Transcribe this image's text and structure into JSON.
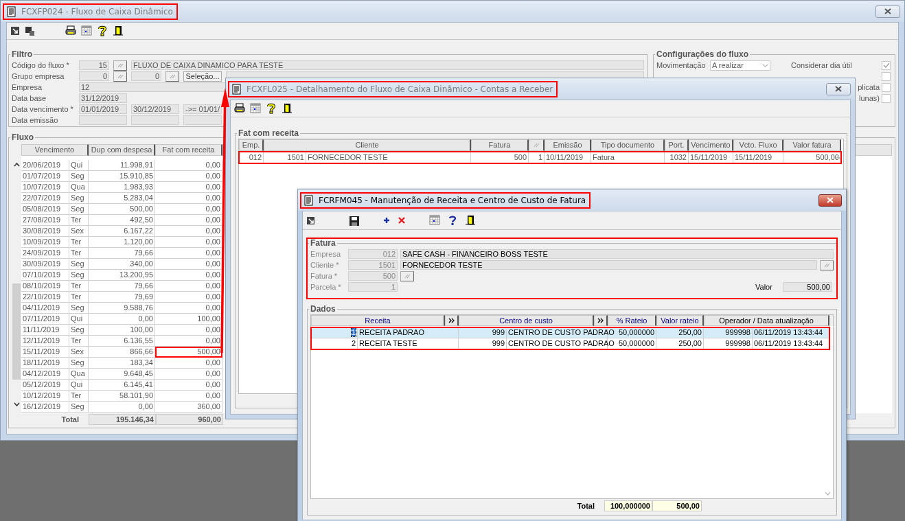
{
  "main_window": {
    "title": "FCXFP024 - Fluxo de Caixa Dinâmico",
    "highlighted": true,
    "filter": {
      "title": "Filtro",
      "rows": [
        {
          "label": "Código do fluxo *",
          "cells": [
            {
              "kind": "num",
              "text": "15"
            },
            {
              "kind": "lookup"
            },
            {
              "kind": "desc",
              "text": "FLUXO DE CAIXA DINAMICO PARA TESTE"
            }
          ]
        },
        {
          "label": "Grupo empresa",
          "cells": [
            {
              "kind": "num",
              "text": "0"
            },
            {
              "kind": "lookup"
            },
            {
              "kind": "num",
              "text": "0"
            },
            {
              "kind": "lookup"
            },
            {
              "kind": "button",
              "text": "Seleção..."
            },
            {
              "kind": "desc"
            }
          ]
        },
        {
          "label": "Empresa",
          "cells": [
            {
              "kind": "desc",
              "text": "12"
            }
          ]
        },
        {
          "label": "Data base",
          "cells": [
            {
              "kind": "date",
              "text": "31/12/2019"
            }
          ]
        },
        {
          "label": "Data vencimento *",
          "cells": [
            {
              "kind": "date",
              "text": "01/01/2019"
            },
            {
              "kind": "date",
              "text": "30/12/2019"
            },
            {
              "kind": "date",
              "text": "->= 01/01/"
            }
          ]
        },
        {
          "label": "Data emissão",
          "cells": [
            {
              "kind": "date"
            },
            {
              "kind": "date"
            },
            {
              "kind": "date"
            }
          ]
        }
      ]
    },
    "config": {
      "title": "Configurações do fluxo",
      "movement": {
        "label": "Movimentação",
        "value": "A realizar"
      },
      "checks": [
        {
          "label": "Considerar dia útil",
          "checked": true
        },
        {
          "checked": false
        },
        {
          "label": "plicata",
          "checked": false
        },
        {
          "label": "lunas)",
          "checked": false
        }
      ]
    },
    "flow": {
      "title": "Fluxo",
      "columns": [
        "Vencimento",
        "Dup com despesa",
        "Fat com receita"
      ],
      "rows": [
        {
          "date": "20/06/2019",
          "weekday": "Qui",
          "dup": "11.998,91",
          "fat": "0,00",
          "highlighted": false
        },
        {
          "date": "01/07/2019",
          "weekday": "Seg",
          "dup": "15.910,85",
          "fat": "0,00",
          "highlighted": false
        },
        {
          "date": "10/07/2019",
          "weekday": "Qua",
          "dup": "1.983,93",
          "fat": "0,00",
          "highlighted": false
        },
        {
          "date": "22/07/2019",
          "weekday": "Seg",
          "dup": "5.283,04",
          "fat": "0,00",
          "highlighted": false
        },
        {
          "date": "05/08/2019",
          "weekday": "Seg",
          "dup": "500,00",
          "fat": "0,00",
          "highlighted": false
        },
        {
          "date": "27/08/2019",
          "weekday": "Ter",
          "dup": "492,50",
          "fat": "0,00",
          "highlighted": false
        },
        {
          "date": "30/08/2019",
          "weekday": "Sex",
          "dup": "6.167,22",
          "fat": "0,00",
          "highlighted": false
        },
        {
          "date": "10/09/2019",
          "weekday": "Ter",
          "dup": "1.120,00",
          "fat": "0,00",
          "highlighted": false
        },
        {
          "date": "24/09/2019",
          "weekday": "Ter",
          "dup": "79,66",
          "fat": "0,00",
          "highlighted": false
        },
        {
          "date": "30/09/2019",
          "weekday": "Seg",
          "dup": "340,00",
          "fat": "0,00",
          "highlighted": false
        },
        {
          "date": "07/10/2019",
          "weekday": "Seg",
          "dup": "13.200,95",
          "fat": "0,00",
          "highlighted": false
        },
        {
          "date": "08/10/2019",
          "weekday": "Ter",
          "dup": "79,66",
          "fat": "0,00",
          "highlighted": false
        },
        {
          "date": "22/10/2019",
          "weekday": "Ter",
          "dup": "79,69",
          "fat": "0,00",
          "highlighted": false
        },
        {
          "date": "04/11/2019",
          "weekday": "Seg",
          "dup": "9.588,76",
          "fat": "0,00",
          "highlighted": false
        },
        {
          "date": "07/11/2019",
          "weekday": "Qui",
          "dup": "0,00",
          "fat": "100,00",
          "highlighted": false
        },
        {
          "date": "11/11/2019",
          "weekday": "Seg",
          "dup": "100,00",
          "fat": "0,00",
          "highlighted": false
        },
        {
          "date": "12/11/2019",
          "weekday": "Ter",
          "dup": "6.136,55",
          "fat": "0,00",
          "highlighted": false
        },
        {
          "date": "15/11/2019",
          "weekday": "Sex",
          "dup": "866,66",
          "fat": "500,00",
          "highlighted": true
        },
        {
          "date": "18/11/2019",
          "weekday": "Seg",
          "dup": "183,34",
          "fat": "0,00",
          "highlighted": false
        },
        {
          "date": "04/12/2019",
          "weekday": "Qua",
          "dup": "9.648,45",
          "fat": "0,00",
          "highlighted": false
        },
        {
          "date": "05/12/2019",
          "weekday": "Qui",
          "dup": "6.145,41",
          "fat": "0,00",
          "highlighted": false
        },
        {
          "date": "10/12/2019",
          "weekday": "Ter",
          "dup": "58.101,90",
          "fat": "0,00",
          "highlighted": false
        },
        {
          "date": "16/12/2019",
          "weekday": "Seg",
          "dup": "0,00",
          "fat": "360,00",
          "highlighted": false
        }
      ],
      "total": {
        "label": "Total",
        "dup": "195.146,34",
        "fat": "960,00"
      }
    }
  },
  "detail_window": {
    "title": "FCXFL025 - Detalhamento do Fluxo de Caixa Dinâmico - Contas a Receber",
    "highlighted": true,
    "group": "Fat com receita",
    "columns": [
      {
        "kind": "text",
        "label": "Emp."
      },
      {
        "kind": "text",
        "label": "Cliente"
      },
      {
        "kind": "text",
        "label": "Fatura"
      },
      {
        "kind": "lookup"
      },
      {
        "kind": "text",
        "label": "Emissão"
      },
      {
        "kind": "text",
        "label": "Tipo documento"
      },
      {
        "kind": "text",
        "label": "Port."
      },
      {
        "kind": "text",
        "label": "Vencimento"
      },
      {
        "kind": "text",
        "label": "Vcto. Fluxo"
      },
      {
        "kind": "text",
        "label": "Valor fatura"
      }
    ],
    "rows": [
      {
        "highlighted": true,
        "cells": [
          "012",
          {
            "code": "1501",
            "text": "FORNECEDOR TESTE"
          },
          "500",
          "1",
          "10/11/2019",
          "Fatura",
          "1032",
          "15/11/2019",
          "15/11/2019",
          "500,00"
        ]
      }
    ]
  },
  "maint_window": {
    "title": "FCRFM045 - Manutenção de Receita e Centro de Custo de Fatura",
    "highlighted": true,
    "invoice": {
      "title": "Fatura",
      "highlighted": true,
      "fields": [
        {
          "label": "Empresa",
          "code": "012",
          "description": "SAFE CASH - FINANCEIRO BOSS TESTE"
        },
        {
          "label": "Cliente *",
          "code": "1501",
          "description": "FORNECEDOR TESTE"
        },
        {
          "label": "Fatura *",
          "code": "500"
        },
        {
          "label": "Parcela *",
          "code": "1"
        }
      ],
      "value_label": "Valor",
      "value": "500,00"
    },
    "data": {
      "title": "Dados",
      "highlighted": true,
      "columns": [
        {
          "kind": "expandable",
          "label": "Receita",
          "color": "#000080"
        },
        {
          "kind": "expandable",
          "label": "Centro de custo",
          "color": "#000080"
        },
        {
          "kind": "plain",
          "label": "% Rateio",
          "color": "#000080"
        },
        {
          "kind": "plain",
          "label": "Valor rateio",
          "color": "#000080"
        },
        {
          "kind": "plain",
          "label": "Operador / Data atualização",
          "color": "#000000"
        }
      ],
      "rows": [
        {
          "selected": true,
          "cells": [
            {
              "code": "1",
              "text": "RECEITA PADRAO"
            },
            {
              "code": "999",
              "text": "CENTRO DE CUSTO PADRAO"
            },
            "50,000000",
            "250,00",
            {
              "code": "999998",
              "text": "06/11/2019 13:43:44"
            }
          ]
        },
        {
          "selected": false,
          "cells": [
            {
              "code": "2",
              "text": "RECEITA TESTE"
            },
            {
              "code": "999",
              "text": "CENTRO DE CUSTO PADRAO"
            },
            "50,000000",
            "250,00",
            {
              "code": "999998",
              "text": "06/11/2019 13:43:44"
            }
          ]
        }
      ],
      "total": {
        "label": "Total",
        "percent": "100,000000",
        "value": "500,00"
      }
    }
  }
}
